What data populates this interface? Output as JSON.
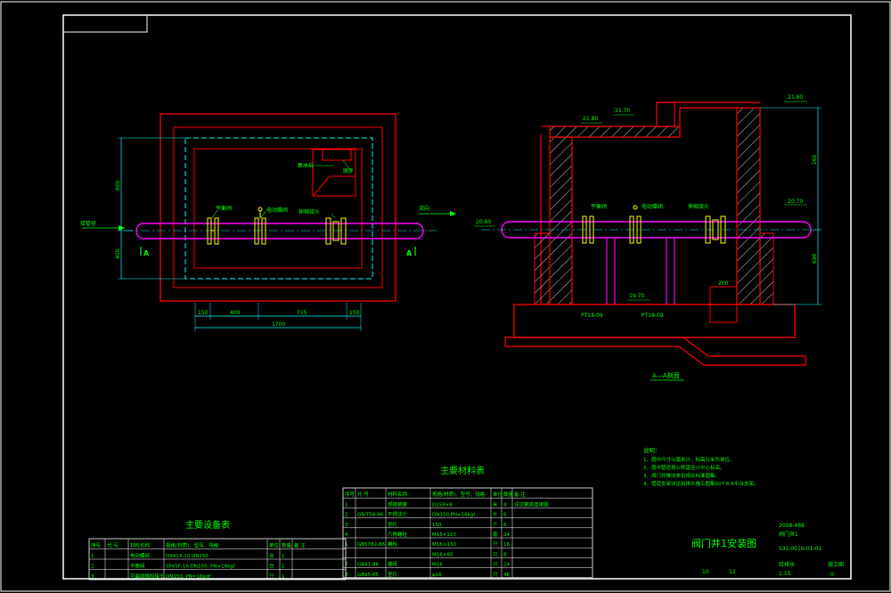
{
  "colors": {
    "background": "#000000",
    "frame": "#ffffff",
    "wall": "#ff0000",
    "pipe": "#ff00ff",
    "dimension": "#00ffff",
    "text": "#00ff00",
    "valve": "#ffff00",
    "hatch": "#ffffff"
  },
  "plan": {
    "label_a1": "A",
    "label_a2": "A",
    "pipe_label_left": "接管径",
    "valve_labels": [
      "平衡阀",
      "电动蝶阀",
      "伸缩接头"
    ],
    "flow_label_right": "流向",
    "ladder_label": "踏步",
    "top_note": "集水坑",
    "dims_bottom": [
      "150",
      "400",
      "715",
      "150"
    ],
    "dim_total": "1700",
    "dims_left": [
      "600",
      "400"
    ]
  },
  "section": {
    "title": "A—A剖面",
    "elev_top_left": "21.80",
    "elev_top_mid": "21.70",
    "elev_top_right": "21.80",
    "elev_pipe_left": "20.60",
    "elev_pipe_right": "20.70",
    "elev_bottom": "19.70",
    "support_left": "PT18-09",
    "support_right": "PT18-09",
    "valve_labels": [
      "平衡阀",
      "电动蝶阀",
      "伸缩接头"
    ],
    "dims_right": [
      "160",
      "690"
    ],
    "dim_small": "200"
  },
  "notes": {
    "heading": "说明：",
    "lines": [
      "1、图中尺寸以毫米计，标高以米为单位。",
      "2、图中管道按公称直径计中心标高。",
      "3、阀门井做法参见相关标准图集。",
      "4、管道支架详见给排水施工图集S07-6-6平台支架。"
    ]
  },
  "material_table": {
    "title": "主要材料表",
    "headers": [
      "序号",
      "代 号",
      "材料名称",
      "规格(材质)、型号、规格",
      "单位",
      "数量",
      "备 注"
    ],
    "rows": [
      [
        "1",
        "",
        "焊接钢管",
        "D159×6",
        "米",
        "4",
        "详见管道连接图"
      ],
      [
        "2",
        "GB/T58-96",
        "平焊法兰",
        "DN150,PN=16kgf",
        "片",
        "6",
        ""
      ],
      [
        "3",
        "",
        "垫片",
        "150",
        "个",
        "6",
        ""
      ],
      [
        "4",
        "",
        "六角螺栓",
        "M16×110",
        "套",
        "24",
        ""
      ],
      [
        "5",
        "GB5782-86",
        "螺栓",
        "M16×130",
        "只",
        "16",
        ""
      ],
      [
        "",
        "",
        "",
        "M16×60",
        "只",
        "8",
        ""
      ],
      [
        "7",
        "GB41-86",
        "螺母",
        "M16",
        "只",
        "24",
        ""
      ],
      [
        "8",
        "GB95-85",
        "垫片",
        "φ16",
        "只",
        "48",
        ""
      ]
    ]
  },
  "equipment_table": {
    "title": "主要设备表",
    "headers": [
      "序号",
      "代 号",
      "材料名称",
      "规格(材质)、型号、规格",
      "单位",
      "数量",
      "备 注"
    ],
    "rows": [
      [
        "1",
        "",
        "电动蝶阀",
        "D941X-10 DN150",
        "台",
        "1",
        ""
      ],
      [
        "2",
        "",
        "平衡阀",
        "SP45F-16 DN150, PN=16kgf",
        "台",
        "1",
        ""
      ],
      [
        "3",
        "",
        "可曲挠橡胶接头",
        "DN150, PN=16kgf",
        "只",
        "1",
        ""
      ]
    ]
  },
  "title_block": {
    "drawing_title": "阀门井1安装图",
    "project_code": "2008-486",
    "project_name": "阀门井1",
    "drawing_no": "S31.0019-01-01",
    "discipline": "给排水",
    "scale": "1:15",
    "stage": "施工图",
    "sheet": "10",
    "total": "12",
    "revision": "0"
  }
}
